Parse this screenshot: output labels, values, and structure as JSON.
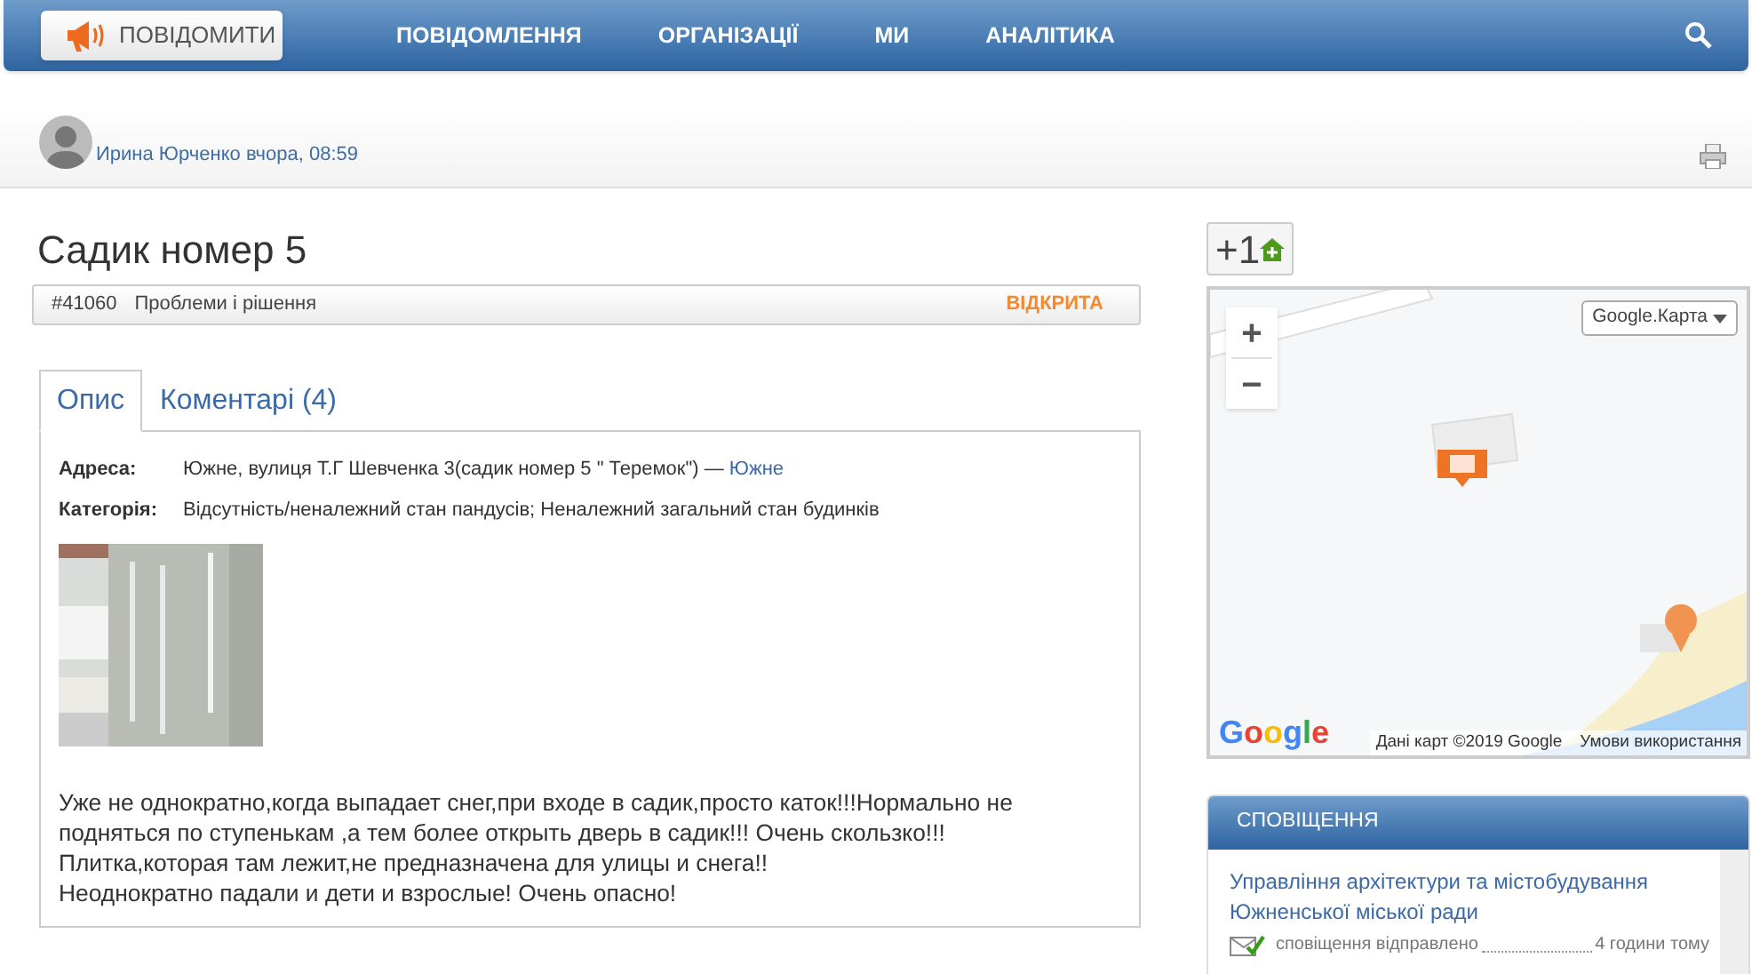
{
  "header": {
    "report_button": "ПОВІДОМИТИ",
    "nav": [
      {
        "label": "ПОВІДОМЛЕННЯ"
      },
      {
        "label": "ОРГАНІЗАЦІЇ"
      },
      {
        "label": "МИ"
      },
      {
        "label": "АНАЛІТИКА"
      }
    ]
  },
  "author": {
    "name": "Ирина Юрченко",
    "time": "вчора, 08:59"
  },
  "title": "Садик номер 5",
  "meta": {
    "number": "#41060",
    "category": "Проблеми і рішення",
    "status": "ВІДКРИТА"
  },
  "tabs": [
    {
      "label": "Опис",
      "selected": true
    },
    {
      "label": "Коментарі (4)",
      "selected": false
    }
  ],
  "details": [
    {
      "label": "Адреса:",
      "value": "Южне, вулиця Т.Г Шевченка 3(садик номер 5 \" Теремок\") — ",
      "link": "Южне"
    },
    {
      "label": "Категорія:",
      "value": "Відсутність/неналежний стан пандусів; Неналежний загальний стан будинків"
    }
  ],
  "description": "Уже не однократно,когда выпадает снег,при входе в садик,просто каток!!!Нормально не подняться по ступенькам ,а тем более открыть дверь в садик!!! Очень скользко!!!\nПлитка,которая там лежит,не предназначена для улицы и снега!!\nНеоднократно падали и дети и взрослые! Очень опасно!",
  "vote": {
    "label": "+1"
  },
  "map": {
    "zoom_in": "+",
    "zoom_out": "−",
    "layer": "Google.Карта",
    "logo": "Google",
    "attribution": "Дані карт ©2019 Google",
    "terms": "Умови використання"
  },
  "notifications": {
    "title": "СПОВІЩЕННЯ",
    "items": [
      {
        "organization": "Управління архітектури та містобудування Южненської міської ради",
        "status": "сповіщення відправлено",
        "time": "4 години тому"
      }
    ]
  }
}
